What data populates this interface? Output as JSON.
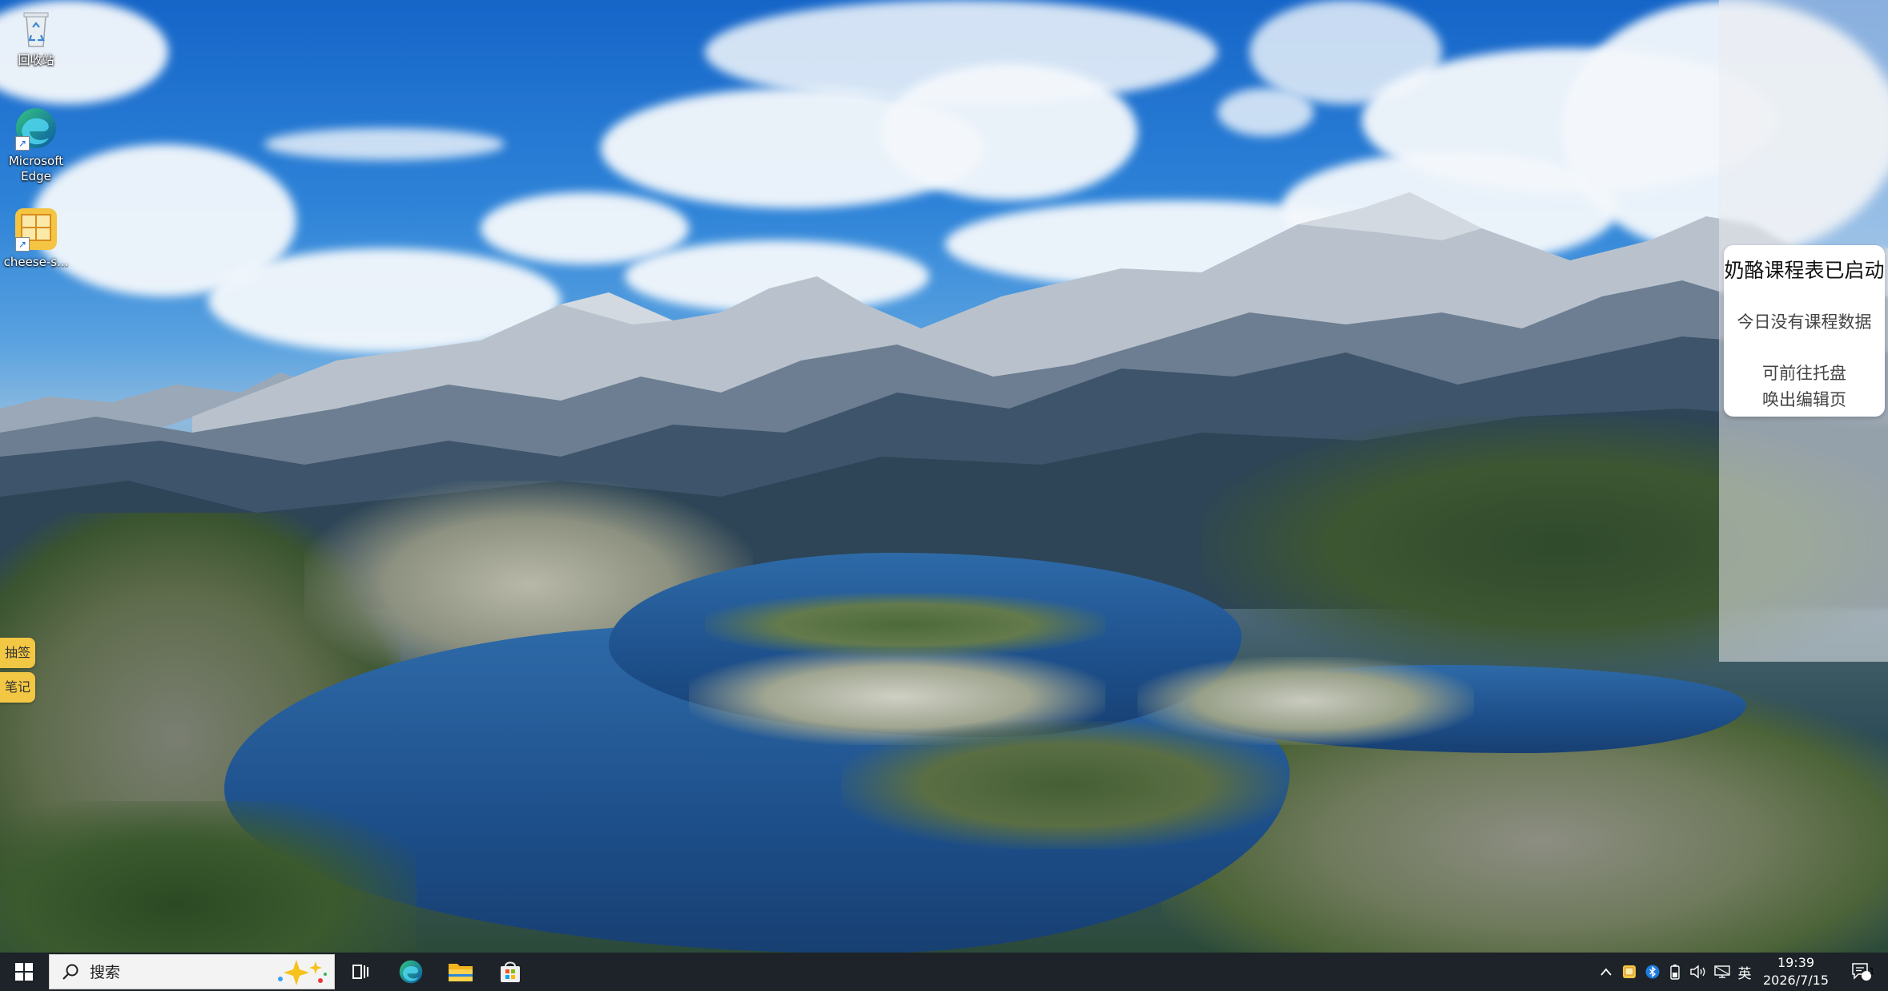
{
  "desktop": {
    "icons": [
      {
        "label": "回收站",
        "icon": "recycle-bin-icon"
      },
      {
        "label": "Microsoft Edge",
        "icon": "edge-icon"
      },
      {
        "label": "cheese-s...",
        "icon": "timetable-app-icon"
      }
    ],
    "side_tabs": [
      {
        "label": "抽签"
      },
      {
        "label": "笔记"
      }
    ]
  },
  "notification": {
    "title": "奶酪课程表已启动",
    "line1": "今日没有课程数据",
    "line2a": "可前往托盘",
    "line2b": "唤出编辑页"
  },
  "taskbar": {
    "search_placeholder": "搜索",
    "pinned": [
      "task-view-icon",
      "edge-icon",
      "file-explorer-icon",
      "microsoft-store-icon"
    ],
    "tray": {
      "ime_label": "英",
      "time": "19:39",
      "date": "2026/7/15",
      "notification_count": "1"
    }
  },
  "colors": {
    "taskbar_bg": "#1d2329",
    "side_tab_bg": "#f2c744",
    "accent_blue": "#0078d4"
  }
}
